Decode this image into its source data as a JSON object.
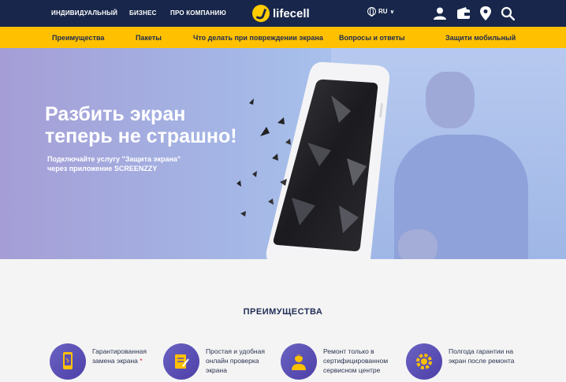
{
  "topnav": {
    "items": [
      "ИНДИВИДУАЛЬНЫЙ",
      "БИЗНЕС",
      "ПРО КОМПАНИЮ"
    ],
    "logo_text": "lifecell",
    "lang": "RU"
  },
  "subnav": {
    "items": [
      "Преимущества",
      "Пакеты",
      "Что делать при повреждении экрана",
      "Вопросы и ответы",
      "Защити мобильный"
    ]
  },
  "hero": {
    "title_line1": "Разбить экран",
    "title_line2": "теперь не страшно!",
    "subtitle_line1": "Подключайте услугу \"Защита экрана\"",
    "subtitle_line2": "через приложение SCREENZZY"
  },
  "advantages": {
    "title": "ПРЕИМУЩЕСТВА",
    "items": [
      {
        "line1": "Гарантированная",
        "line2": "замена экрана",
        "star": "*",
        "line3": ""
      },
      {
        "line1": "Простая и удобная",
        "line2": "онлайн проверка",
        "star": "",
        "line3": "экрана"
      },
      {
        "line1": "Ремонт только в",
        "line2": "сертифицированном",
        "star": "",
        "line3": "сервисном центре"
      },
      {
        "line1": "Полгода гарантии на",
        "line2": "экран после ремонта",
        "star": "",
        "line3": ""
      }
    ]
  },
  "colors": {
    "topbar": "#17264a",
    "accent_yellow": "#ffc000",
    "icon_purple": "#5b4fb6"
  }
}
